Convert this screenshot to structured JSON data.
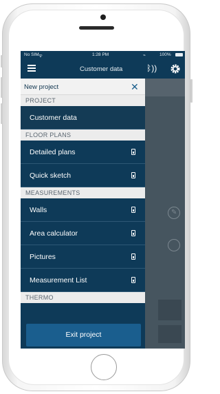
{
  "status_bar": {
    "carrier": "No SIM",
    "time": "1:28 PM",
    "battery": "100%"
  },
  "nav_bar": {
    "title": "Customer data"
  },
  "drawer": {
    "header_title": "New project",
    "sections": [
      {
        "title": "PROJECT",
        "items": [
          {
            "label": "Customer data",
            "active": true
          }
        ]
      },
      {
        "title": "FLOOR PLANS",
        "items": [
          {
            "label": "Detailed plans"
          },
          {
            "label": "Quick sketch"
          }
        ]
      },
      {
        "title": "MEASUREMENTS",
        "items": [
          {
            "label": "Walls"
          },
          {
            "label": "Area calculator"
          },
          {
            "label": "Pictures"
          },
          {
            "label": "Measurement List"
          }
        ]
      },
      {
        "title": "THERMO",
        "items": []
      }
    ],
    "exit_label": "Exit project"
  },
  "colors": {
    "nav_background": "#0e3a58",
    "section_background": "#ececec",
    "exit_button": "#1a5e8e"
  }
}
